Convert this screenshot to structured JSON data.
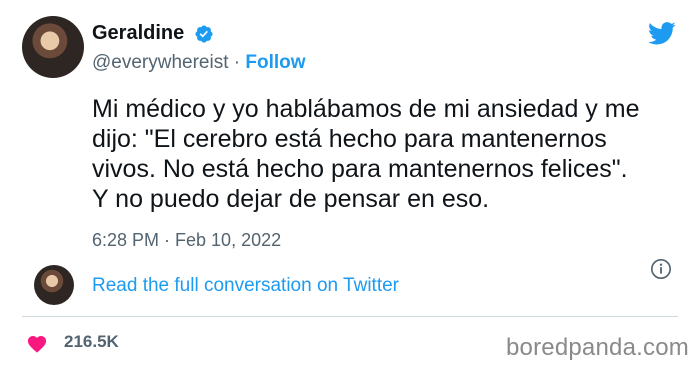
{
  "author": {
    "name": "Geraldine",
    "handle": "@everywhereist",
    "separator": "·",
    "follow_label": "Follow"
  },
  "tweet": {
    "lines": [
      "Mi médico y yo hablábamos de mi ansiedad y me",
      "dijo: \"El cerebro está hecho para mantenernos",
      "vivos. No está hecho para mantenernos felices\".",
      "Y no puedo dejar de pensar en eso."
    ],
    "timestamp": "6:28 PM · Feb 10, 2022"
  },
  "conversation": {
    "link_label": "Read the full conversation on Twitter"
  },
  "engagement": {
    "likes": "216.5K"
  },
  "watermark": "boredpanda.com",
  "colors": {
    "accent": "#1d9bf0",
    "heart": "#f91880",
    "secondary_text": "#536471"
  },
  "icons": {
    "verified": "verified-badge-icon",
    "brand": "twitter-bird-icon",
    "info": "info-icon",
    "like": "heart-icon"
  }
}
